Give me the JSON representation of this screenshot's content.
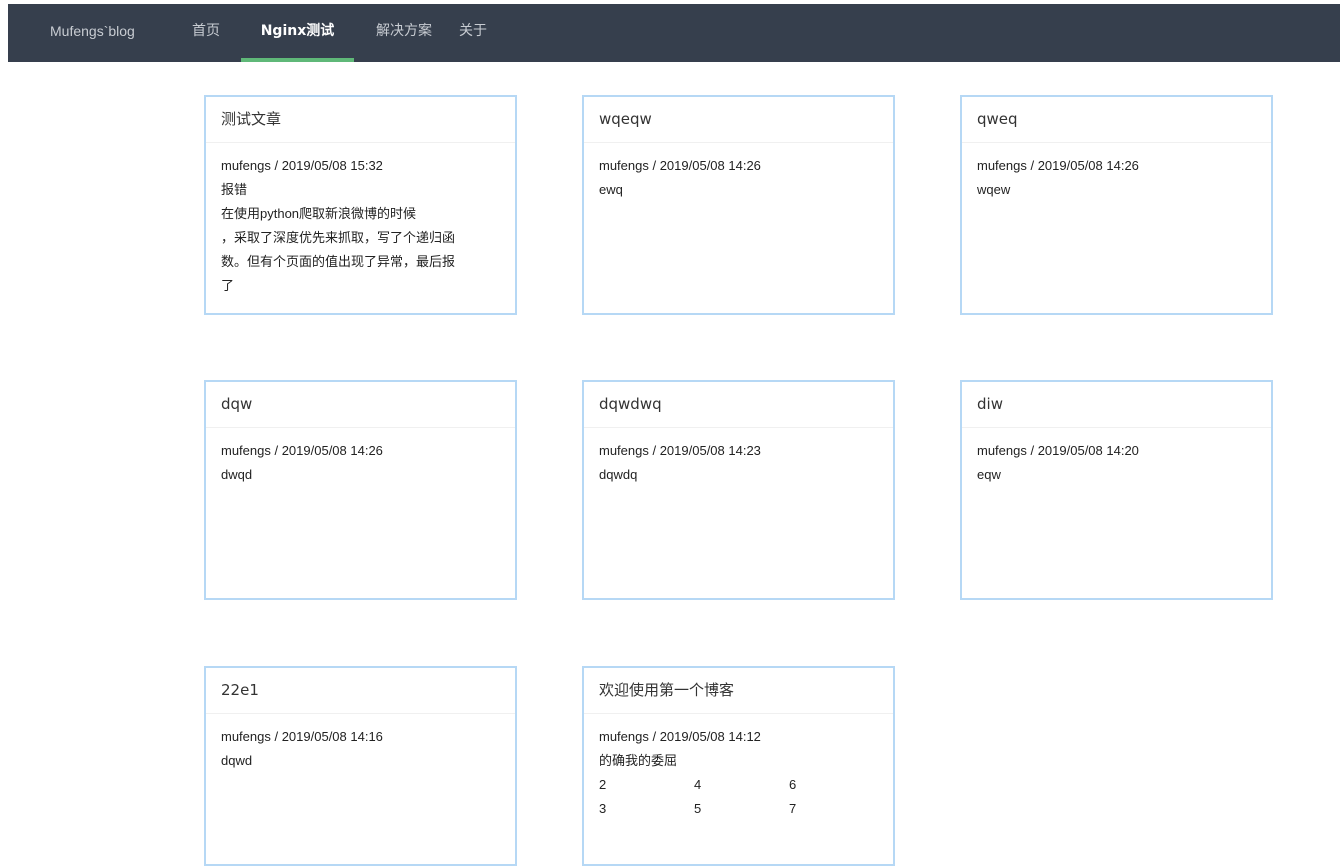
{
  "nav": {
    "brand": "Mufengs`blog",
    "links": [
      "首页",
      "Nginx测试",
      "解决方案",
      "关于"
    ],
    "active": "Nginx测试",
    "accent": "#5fb878",
    "background": "#363f4d"
  },
  "posts": [
    {
      "title": "测试文章",
      "meta": "mufengs / 2019/05/08 15:32",
      "lines": [
        "报错",
        "在使用python爬取新浪微博的时候",
        "，采取了深度优先来抓取，写了个递归函",
        "数。但有个页面的值出现了异常，最后报",
        "了"
      ]
    },
    {
      "title": "wqeqw",
      "meta": "mufengs / 2019/05/08 14:26",
      "lines": [
        "ewq"
      ]
    },
    {
      "title": "qweq",
      "meta": "mufengs / 2019/05/08 14:26",
      "lines": [
        "wqew"
      ]
    },
    {
      "title": "dqw",
      "meta": "mufengs / 2019/05/08 14:26",
      "lines": [
        "dwqd"
      ]
    },
    {
      "title": "dqwdwq",
      "meta": "mufengs / 2019/05/08 14:23",
      "lines": [
        "dqwdq"
      ]
    },
    {
      "title": "diw",
      "meta": "mufengs / 2019/05/08 14:20",
      "lines": [
        "eqw"
      ]
    },
    {
      "title": "22e1",
      "meta": "mufengs / 2019/05/08 14:16",
      "lines": [
        "dqwd"
      ]
    },
    {
      "title": "欢迎使用第一个博客",
      "meta": "mufengs / 2019/05/08 14:12",
      "lines": [
        "的确我的委屈"
      ],
      "grid": [
        [
          "2",
          "4",
          "6"
        ],
        [
          "3",
          "5",
          "7"
        ]
      ]
    }
  ],
  "colors": {
    "card_border": "#b6d8f5"
  }
}
